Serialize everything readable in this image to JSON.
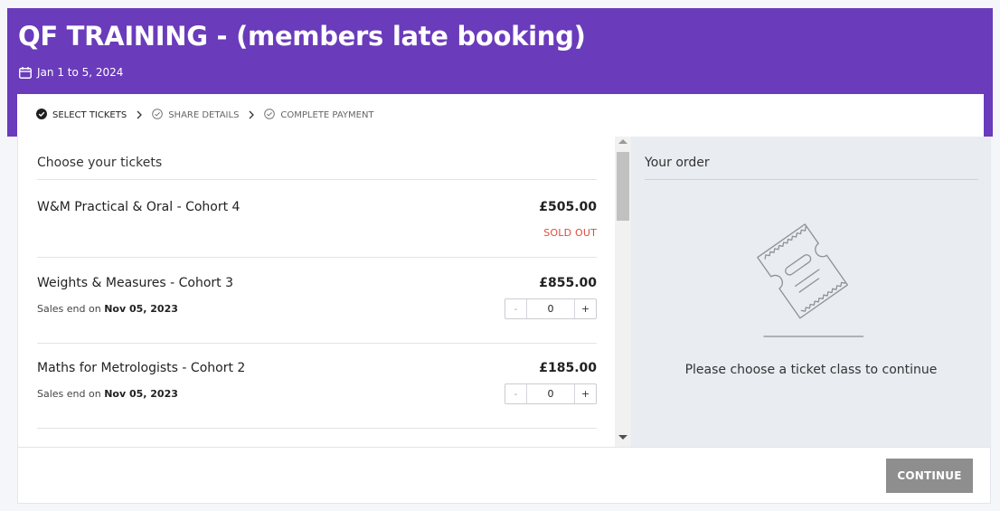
{
  "event": {
    "title": "QF TRAINING - (members late booking)",
    "date_range": "Jan 1 to 5, 2024"
  },
  "steps": [
    {
      "label": "SELECT TICKETS",
      "state": "active"
    },
    {
      "label": "SHARE DETAILS",
      "state": "pending"
    },
    {
      "label": "COMPLETE PAYMENT",
      "state": "pending"
    }
  ],
  "tickets_section": {
    "heading": "Choose your tickets",
    "sales_prefix": "Sales end on",
    "tickets": [
      {
        "name": "W&M Practical & Oral - Cohort 4",
        "price": "£505.00",
        "status": "SOLD OUT"
      },
      {
        "name": "Weights & Measures - Cohort 3",
        "price": "£855.00",
        "sales_end": "Nov 05, 2023",
        "quantity": "0"
      },
      {
        "name": "Maths for Metrologists - Cohort 2",
        "price": "£185.00",
        "sales_end": "Nov 05, 2023",
        "quantity": "0"
      }
    ],
    "stepper": {
      "minus": "-",
      "plus": "+"
    }
  },
  "order": {
    "heading": "Your order",
    "empty_message": "Please choose a ticket class to continue"
  },
  "footer": {
    "continue_label": "CONTINUE"
  },
  "colors": {
    "header_bg": "#6a3bbb",
    "sold_out": "#e04b3b",
    "continue_bg": "#8e8e8e",
    "order_panel_bg": "#e9ecf1"
  },
  "icons": {
    "date": "calendar-icon",
    "step_active": "check-circle-filled-icon",
    "step_pending": "check-circle-outline-icon",
    "step_separator": "chevron-right-icon",
    "order_empty": "ticket-illustration"
  }
}
